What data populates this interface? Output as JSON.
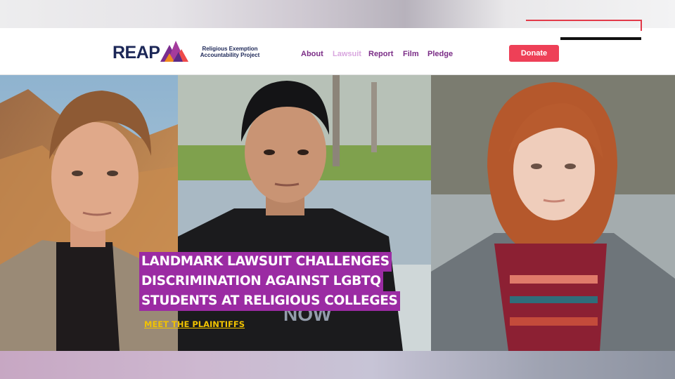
{
  "brand": {
    "logo_text": "REAP",
    "logo_subtitle": "Religious Exemption Accountability Project"
  },
  "nav": {
    "items": [
      {
        "label": "About",
        "active": false
      },
      {
        "label": "Lawsuit",
        "active": true
      },
      {
        "label": "Report",
        "active": false
      },
      {
        "label": "Film",
        "active": false
      },
      {
        "label": "Pledge",
        "active": false
      }
    ]
  },
  "donate_label": "Donate",
  "hero": {
    "headline_lines": [
      "LANDMARK LAWSUIT CHALLENGES",
      "DISCRIMINATION AGAINST LGBTQ",
      "STUDENTS AT RELIGIOUS COLLEGES"
    ],
    "cta_label": "MEET THE PLAINTIFFS"
  },
  "colors": {
    "navy": "#1c2757",
    "nav_purple": "#7a2c86",
    "nav_active": "#d9a7df",
    "donate_red": "#ee4057",
    "headline_bg": "#9b2ba3",
    "cta_yellow": "#f2c300"
  }
}
